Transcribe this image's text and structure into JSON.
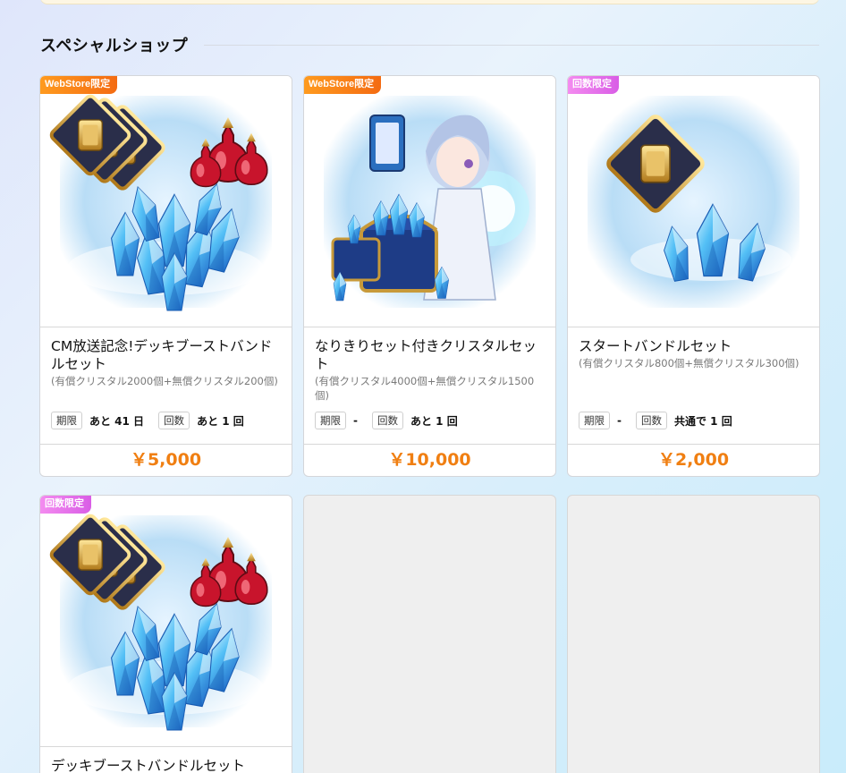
{
  "section": {
    "title": "スペシャルショップ"
  },
  "products": [
    {
      "badge": "WebStore限定",
      "badge_color": "#f47a14",
      "title": "CM放送記念!デッキブーストバンドルセット",
      "subtitle": "(有償クリスタル2000個+無償クリスタル200個)",
      "period_label": "期限",
      "period_value": "あと 41 日",
      "count_label": "回数",
      "count_value": "あと 1 回",
      "price": "￥5,000",
      "image_icon": "deck-boost-bundle-image"
    },
    {
      "badge": "WebStore限定",
      "badge_color": "#f47a14",
      "title": "なりきりセット付きクリスタルセット",
      "subtitle": "(有償クリスタル4000個+無償クリスタル1500個)",
      "period_label": "期限",
      "period_value": "-",
      "count_label": "回数",
      "count_value": "あと 1 回",
      "price": "￥10,000",
      "image_icon": "character-treasure-chest-image"
    },
    {
      "badge": "回数限定",
      "badge_color": "#e06ce9",
      "title": "スタートバンドルセット",
      "subtitle": "(有償クリスタル800個+無償クリスタル300個)",
      "period_label": "期限",
      "period_value": "-",
      "count_label": "回数",
      "count_value": "共通で 1 回",
      "price": "￥2,000",
      "image_icon": "start-bundle-image"
    },
    {
      "badge": "回数限定",
      "badge_color": "#e06ce9",
      "title": "デッキブーストバンドルセット",
      "image_icon": "deck-boost-bundle-image"
    }
  ],
  "colors": {
    "price": "#f07f12",
    "badge_orange": "#f47a14",
    "badge_pink": "#e06ce9",
    "crystal": "#3aa6f0"
  }
}
